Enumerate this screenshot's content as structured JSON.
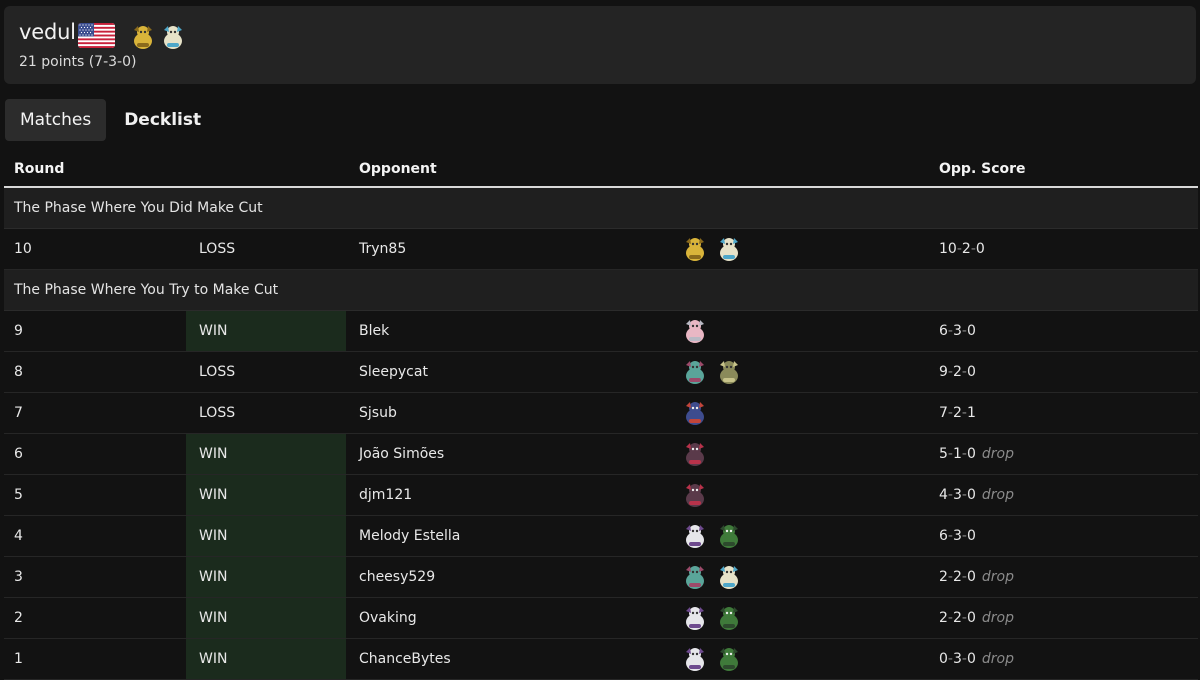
{
  "player": {
    "name": "vedul",
    "country": "United States",
    "record": "21 points (7-3-0)",
    "deck_icons": [
      "alakazam-icon",
      "dudunsparce-icon"
    ]
  },
  "tabs": [
    {
      "label": "Matches",
      "active": true
    },
    {
      "label": "Decklist",
      "active": false
    }
  ],
  "table": {
    "headers": {
      "round": "Round",
      "opponent": "Opponent",
      "score": "Opp. Score"
    },
    "sections": [
      {
        "title": "The Phase Where You Did Make Cut",
        "rows": [
          {
            "round": "10",
            "result": "LOSS",
            "opponent": "Tryn85",
            "deck": [
              "alakazam-icon",
              "dudunsparce-icon"
            ],
            "score": [
              "10",
              "2",
              "0"
            ],
            "drop": ""
          }
        ]
      },
      {
        "title": "The Phase Where You Try to Make Cut",
        "rows": [
          {
            "round": "9",
            "result": "WIN",
            "opponent": "Blek",
            "deck": [
              "tinkaton-icon"
            ],
            "score": [
              "6",
              "3",
              "0"
            ],
            "drop": ""
          },
          {
            "round": "8",
            "result": "LOSS",
            "opponent": "Sleepycat",
            "deck": [
              "dragapult-icon",
              "bronzong-icon"
            ],
            "score": [
              "9",
              "2",
              "0"
            ],
            "drop": ""
          },
          {
            "round": "7",
            "result": "LOSS",
            "opponent": "Sjsub",
            "deck": [
              "garchomp-icon"
            ],
            "score": [
              "7",
              "2",
              "1"
            ],
            "drop": ""
          },
          {
            "round": "6",
            "result": "WIN",
            "opponent": "João Simões",
            "deck": [
              "zoroark-icon"
            ],
            "score": [
              "5",
              "1",
              "0"
            ],
            "drop": "drop"
          },
          {
            "round": "5",
            "result": "WIN",
            "opponent": "djm121",
            "deck": [
              "zoroark-icon"
            ],
            "score": [
              "4",
              "3",
              "0"
            ],
            "drop": "drop"
          },
          {
            "round": "4",
            "result": "WIN",
            "opponent": "Melody Estella",
            "deck": [
              "gardevoir-icon",
              "ogerpon-icon"
            ],
            "score": [
              "6",
              "3",
              "0"
            ],
            "drop": ""
          },
          {
            "round": "3",
            "result": "WIN",
            "opponent": "cheesy529",
            "deck": [
              "dragapult-icon",
              "dudunsparce-icon"
            ],
            "score": [
              "2",
              "2",
              "0"
            ],
            "drop": "drop"
          },
          {
            "round": "2",
            "result": "WIN",
            "opponent": "Ovaking",
            "deck": [
              "gardevoir-icon",
              "ogerpon-icon"
            ],
            "score": [
              "2",
              "2",
              "0"
            ],
            "drop": "drop"
          },
          {
            "round": "1",
            "result": "WIN",
            "opponent": "ChanceBytes",
            "deck": [
              "gardevoir-icon",
              "ogerpon-icon"
            ],
            "score": [
              "0",
              "3",
              "0"
            ],
            "drop": "drop"
          }
        ]
      }
    ]
  },
  "colors": {
    "background": "#121212",
    "card": "#242424",
    "win_cell": "#1b2b1d",
    "muted": "#8a8a8a"
  }
}
